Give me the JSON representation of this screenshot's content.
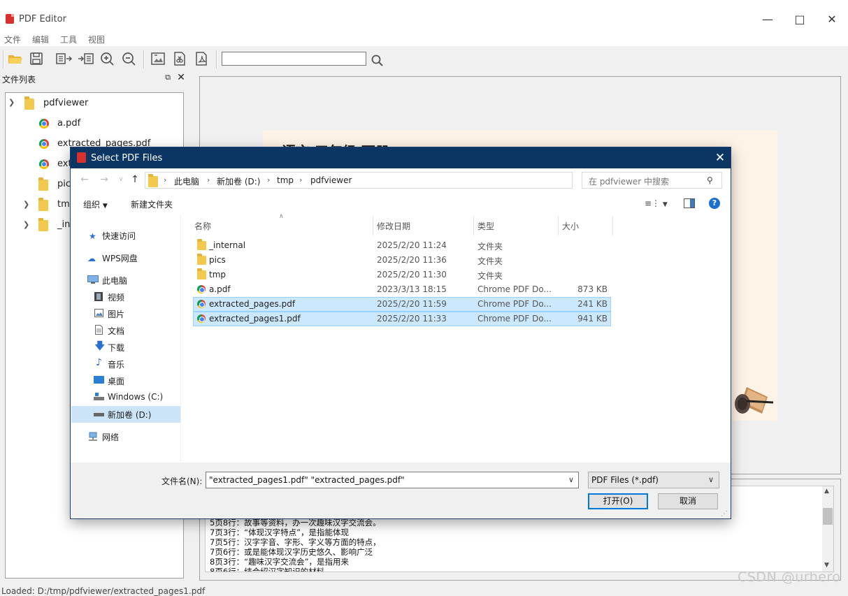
{
  "app": {
    "title": "PDF Editor",
    "menu": [
      "文件",
      "编辑",
      "工具",
      "视图"
    ],
    "search_value": "",
    "dock_title": "文件列表",
    "tree": [
      {
        "label": "pdfviewer",
        "type": "folder",
        "expanded": true
      },
      {
        "label": "a.pdf",
        "type": "pdf"
      },
      {
        "label": "extracted_pages.pdf",
        "type": "pdf"
      },
      {
        "label": "ext",
        "type": "pdf"
      },
      {
        "label": "pic",
        "type": "folder"
      },
      {
        "label": "tmp",
        "type": "folder",
        "expanded": false
      },
      {
        "label": "_int",
        "type": "folder",
        "expanded": false
      }
    ],
    "doc_heading": "语言 三年级 下册",
    "log_lines": [
      "5页8行：故事等资料，办一次趣味汉字交流会。",
      "7页3行：“体现汉字特点”，是指能体现",
      "7页5行：汉字字音、字形、字义等方面的特点，",
      "7页6行：或是能体现汉字历史悠久、影响广泛",
      "8页3行：“趣味汉字交流会”，是指用来",
      "8页6行：结合绍汉字知识的材料"
    ],
    "status": "Loaded: D:/tmp/pdfviewer/extracted_pages1.pdf",
    "watermark": "CSDN @urhero"
  },
  "dialog": {
    "title": "Select PDF Files",
    "breadcrumb": [
      "此电脑",
      "新加卷 (D:)",
      "tmp",
      "pdfviewer"
    ],
    "search_placeholder": "在 pdfviewer 中搜索",
    "organize": "组织",
    "new_folder": "新建文件夹",
    "nav": {
      "quick_access": "快速访问",
      "wps": "WPS网盘",
      "this_pc": "此电脑",
      "videos": "视频",
      "pictures": "图片",
      "documents": "文档",
      "downloads": "下载",
      "music": "音乐",
      "desktop": "桌面",
      "windows_c": "Windows (C:)",
      "drive_d": "新加卷 (D:)",
      "network": "网络"
    },
    "columns": [
      "名称",
      "修改日期",
      "类型",
      "大小"
    ],
    "files": [
      {
        "name": "_internal",
        "date": "2025/2/20 11:24",
        "type": "文件夹",
        "size": "",
        "kind": "folder",
        "selected": false
      },
      {
        "name": "pics",
        "date": "2025/2/20 11:36",
        "type": "文件夹",
        "size": "",
        "kind": "folder",
        "selected": false
      },
      {
        "name": "tmp",
        "date": "2025/2/20 11:30",
        "type": "文件夹",
        "size": "",
        "kind": "folder",
        "selected": false
      },
      {
        "name": "a.pdf",
        "date": "2023/3/13 18:15",
        "type": "Chrome PDF Do...",
        "size": "873 KB",
        "kind": "pdf",
        "selected": false
      },
      {
        "name": "extracted_pages.pdf",
        "date": "2025/2/20 11:59",
        "type": "Chrome PDF Do...",
        "size": "241 KB",
        "kind": "pdf",
        "selected": true
      },
      {
        "name": "extracted_pages1.pdf",
        "date": "2025/2/20 11:33",
        "type": "Chrome PDF Do...",
        "size": "941 KB",
        "kind": "pdf",
        "selected": true
      }
    ],
    "filename_label": "文件名(N):",
    "filename_value": "\"extracted_pages1.pdf\" \"extracted_pages.pdf\"",
    "filter": "PDF Files (*.pdf)",
    "open_button": "打开(O)",
    "cancel_button": "取消"
  }
}
